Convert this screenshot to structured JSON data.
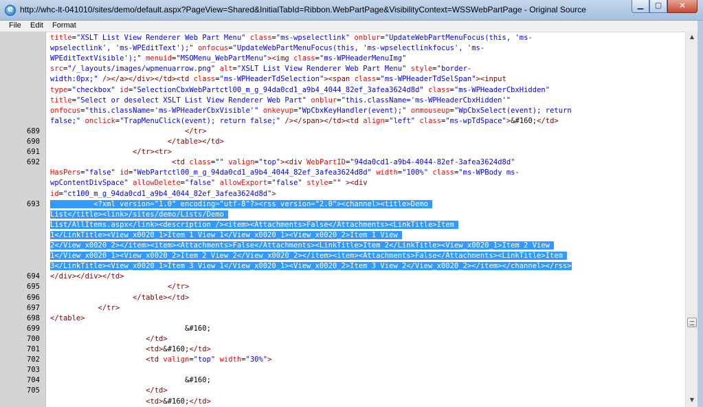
{
  "window": {
    "title": "http://whc-lt-041010/sites/demo/default.aspx?PageView=Shared&InitialTabId=Ribbon.WebPartPage&VisibilityContext=WSSWebPartPage - Original Source",
    "minimize_glyph": "▁",
    "maximize_glyph": "▢",
    "close_glyph": "✕"
  },
  "menu": {
    "file": "File",
    "edit": "Edit",
    "format": "Format"
  },
  "scrollbar": {
    "up": "▲",
    "down": "▼"
  },
  "gutter_numbers": [
    "689",
    "690",
    "691",
    "692",
    "693",
    "694",
    "695",
    "696",
    "697",
    "698",
    "699",
    "700",
    "701",
    "702",
    "703",
    "704",
    "705"
  ],
  "code_lines": [
    {
      "n": "",
      "segs": [
        [
          "a",
          "title"
        ],
        [
          "x",
          "="
        ],
        [
          "v",
          "\"XSLT List View Renderer Web Part Menu\""
        ],
        [
          "x",
          " "
        ],
        [
          "a",
          "class"
        ],
        [
          "x",
          "="
        ],
        [
          "v",
          "\"ms-wpselectlink\""
        ],
        [
          "x",
          " "
        ],
        [
          "a",
          "onblur"
        ],
        [
          "x",
          "="
        ],
        [
          "v",
          "\"UpdateWebPartMenuFocus(this, 'ms-"
        ]
      ]
    },
    {
      "n": "",
      "segs": [
        [
          "v",
          "wpselectlink', 'ms-WPEditText');\""
        ],
        [
          "x",
          " "
        ],
        [
          "a",
          "onfocus"
        ],
        [
          "x",
          "="
        ],
        [
          "v",
          "\"UpdateWebPartMenuFocus(this, 'ms-wpselectlinkfocus', 'ms-"
        ]
      ]
    },
    {
      "n": "",
      "segs": [
        [
          "v",
          "WPEditTextVisible');\""
        ],
        [
          "x",
          " "
        ],
        [
          "a",
          "menuid"
        ],
        [
          "x",
          "="
        ],
        [
          "v",
          "\"MSOMenu_WebPartMenu\""
        ],
        [
          "t",
          "><img"
        ],
        [
          "x",
          " "
        ],
        [
          "a",
          "class"
        ],
        [
          "x",
          "="
        ],
        [
          "v",
          "\"ms-WPHeaderMenuImg\""
        ]
      ]
    },
    {
      "n": "",
      "segs": [
        [
          "a",
          "src"
        ],
        [
          "x",
          "="
        ],
        [
          "v",
          "\"/_layouts/images/wpmenuarrow.png\""
        ],
        [
          "x",
          " "
        ],
        [
          "a",
          "alt"
        ],
        [
          "x",
          "="
        ],
        [
          "v",
          "\"XSLT List View Renderer Web Part Menu\""
        ],
        [
          "x",
          " "
        ],
        [
          "a",
          "style"
        ],
        [
          "x",
          "="
        ],
        [
          "v",
          "\"border-"
        ]
      ]
    },
    {
      "n": "",
      "segs": [
        [
          "v",
          "width:0px;\""
        ],
        [
          "x",
          " "
        ],
        [
          "t",
          "/></a></div></td><td"
        ],
        [
          "x",
          " "
        ],
        [
          "a",
          "class"
        ],
        [
          "x",
          "="
        ],
        [
          "v",
          "\"ms-WPHeaderTdSelection\""
        ],
        [
          "t",
          "><span"
        ],
        [
          "x",
          " "
        ],
        [
          "a",
          "class"
        ],
        [
          "x",
          "="
        ],
        [
          "v",
          "\"ms-WPHeaderTdSelSpan\""
        ],
        [
          "t",
          "><input"
        ]
      ]
    },
    {
      "n": "",
      "segs": [
        [
          "a",
          "type"
        ],
        [
          "x",
          "="
        ],
        [
          "v",
          "\"checkbox\""
        ],
        [
          "x",
          " "
        ],
        [
          "a",
          "id"
        ],
        [
          "x",
          "="
        ],
        [
          "v",
          "\"SelectionCbxWebPartctl00_m_g_94da0cd1_a9b4_4044_82ef_3afea3624d8d\""
        ],
        [
          "x",
          " "
        ],
        [
          "a",
          "class"
        ],
        [
          "x",
          "="
        ],
        [
          "v",
          "\"ms-WPHeaderCbxHidden\""
        ]
      ]
    },
    {
      "n": "",
      "segs": [
        [
          "a",
          "title"
        ],
        [
          "x",
          "="
        ],
        [
          "v",
          "\"Select or deselect XSLT List View Renderer Web Part\""
        ],
        [
          "x",
          " "
        ],
        [
          "a",
          "onblur"
        ],
        [
          "x",
          "="
        ],
        [
          "v",
          "\"this.className='ms-WPHeaderCbxHidden'\""
        ]
      ]
    },
    {
      "n": "",
      "segs": [
        [
          "a",
          "onfocus"
        ],
        [
          "x",
          "="
        ],
        [
          "v",
          "\"this.className='ms-WPHeaderCbxVisible'\""
        ],
        [
          "x",
          " "
        ],
        [
          "a",
          "onkeyup"
        ],
        [
          "x",
          "="
        ],
        [
          "v",
          "\"WpCbxKeyHandler(event);\""
        ],
        [
          "x",
          " "
        ],
        [
          "a",
          "onmouseup"
        ],
        [
          "x",
          "="
        ],
        [
          "v",
          "\"WpCbxSelect(event); return"
        ]
      ]
    },
    {
      "n": "",
      "segs": [
        [
          "v",
          "false;\""
        ],
        [
          "x",
          " "
        ],
        [
          "a",
          "onclick"
        ],
        [
          "x",
          "="
        ],
        [
          "v",
          "\"TrapMenuClick(event); return false;\""
        ],
        [
          "x",
          " "
        ],
        [
          "t",
          "/></span></td><td"
        ],
        [
          "x",
          " "
        ],
        [
          "a",
          "align"
        ],
        [
          "x",
          "="
        ],
        [
          "v",
          "\"left\""
        ],
        [
          "x",
          " "
        ],
        [
          "a",
          "class"
        ],
        [
          "x",
          "="
        ],
        [
          "v",
          "\"ms-wpTdSpace\""
        ],
        [
          "t",
          ">"
        ],
        [
          "e",
          "&#160;"
        ],
        [
          "t",
          "</td>"
        ]
      ]
    },
    {
      "n": "689",
      "segs": [
        [
          "x",
          "                               "
        ],
        [
          "t",
          "</tr>"
        ]
      ]
    },
    {
      "n": "690",
      "segs": [
        [
          "x",
          "                           "
        ],
        [
          "t",
          "</table></td>"
        ]
      ]
    },
    {
      "n": "691",
      "segs": [
        [
          "x",
          "                   "
        ],
        [
          "t",
          "</tr><tr>"
        ]
      ]
    },
    {
      "n": "692",
      "segs": [
        [
          "x",
          "                            "
        ],
        [
          "t",
          "<td"
        ],
        [
          "x",
          " "
        ],
        [
          "a",
          "class"
        ],
        [
          "x",
          "="
        ],
        [
          "v",
          "\"\""
        ],
        [
          "x",
          " "
        ],
        [
          "a",
          "valign"
        ],
        [
          "x",
          "="
        ],
        [
          "v",
          "\"top\""
        ],
        [
          "t",
          "><div"
        ],
        [
          "x",
          " "
        ],
        [
          "a",
          "WebPartID"
        ],
        [
          "x",
          "="
        ],
        [
          "v",
          "\"94da0cd1-a9b4-4044-82ef-3afea3624d8d\""
        ]
      ]
    },
    {
      "n": "",
      "segs": [
        [
          "a",
          "HasPers"
        ],
        [
          "x",
          "="
        ],
        [
          "v",
          "\"false\""
        ],
        [
          "x",
          " "
        ],
        [
          "a",
          "id"
        ],
        [
          "x",
          "="
        ],
        [
          "v",
          "\"WebPartctl00_m_g_94da0cd1_a9b4_4044_82ef_3afea3624d8d\""
        ],
        [
          "x",
          " "
        ],
        [
          "a",
          "width"
        ],
        [
          "x",
          "="
        ],
        [
          "v",
          "\"100%\""
        ],
        [
          "x",
          " "
        ],
        [
          "a",
          "class"
        ],
        [
          "x",
          "="
        ],
        [
          "v",
          "\"ms-WPBody ms-"
        ]
      ]
    },
    {
      "n": "",
      "segs": [
        [
          "v",
          "wpContentDivSpace\""
        ],
        [
          "x",
          " "
        ],
        [
          "a",
          "allowDelete"
        ],
        [
          "x",
          "="
        ],
        [
          "v",
          "\"false\""
        ],
        [
          "x",
          " "
        ],
        [
          "a",
          "allowExport"
        ],
        [
          "x",
          "="
        ],
        [
          "v",
          "\"false\""
        ],
        [
          "x",
          " "
        ],
        [
          "a",
          "style"
        ],
        [
          "x",
          "="
        ],
        [
          "v",
          "\"\""
        ],
        [
          "x",
          " "
        ],
        [
          "t",
          "><div"
        ]
      ]
    },
    {
      "n": "",
      "segs": [
        [
          "a",
          "id"
        ],
        [
          "x",
          "="
        ],
        [
          "v",
          "\"ct100_m_g_94da0cd1_a9b4_4044_82ef_3afea3624d8d\""
        ],
        [
          "t",
          ">"
        ]
      ]
    },
    {
      "n": "693",
      "sel": true,
      "segs": [
        [
          "x",
          "          <?xml version=\"1.0\" encoding=\"utf-8\"?><rss version=\"2.0\"><channel><title>Demo "
        ]
      ]
    },
    {
      "n": "",
      "sel": true,
      "segs": [
        [
          "x",
          "List</title><link>/sites/demo/Lists/Demo "
        ]
      ]
    },
    {
      "n": "",
      "sel": true,
      "segs": [
        [
          "x",
          "List/AllItems.aspx</link><description /><item><Attachments>False</Attachments><LinkTitle>Item "
        ]
      ]
    },
    {
      "n": "",
      "sel": true,
      "segs": [
        [
          "x",
          "1</LinkTitle><View_x0020_1>Item 1 View 1</View_x0020_1><View_x0020_2>Item 1 View "
        ]
      ]
    },
    {
      "n": "",
      "sel": true,
      "segs": [
        [
          "x",
          "2</View_x0020_2></item><item><Attachments>False</Attachments><LinkTitle>Item 2</LinkTitle><View_x0020_1>Item 2 View "
        ]
      ]
    },
    {
      "n": "",
      "sel": true,
      "segs": [
        [
          "x",
          "1</View_x0020_1><View_x0020_2>Item 2 View 2</View_x0020_2></item><item><Attachments>False</Attachments><LinkTitle>Item "
        ]
      ]
    },
    {
      "n": "",
      "sel": true,
      "segs": [
        [
          "x",
          "3</LinkTitle><View_x0020_1>Item 3 View 1</View_x0020_1><View_x0020_2>Item 3 View 2</View_x0020_2></item></channel></rss>"
        ]
      ]
    },
    {
      "n": "694",
      "segs": [
        [
          "t",
          "</div></div></td>"
        ]
      ]
    },
    {
      "n": "695",
      "segs": [
        [
          "x",
          "                           "
        ],
        [
          "t",
          "</tr>"
        ]
      ]
    },
    {
      "n": "696",
      "segs": [
        [
          "x",
          "                   "
        ],
        [
          "t",
          "</table></td>"
        ]
      ]
    },
    {
      "n": "697",
      "segs": [
        [
          "x",
          "           "
        ],
        [
          "t",
          "</tr>"
        ]
      ]
    },
    {
      "n": "698",
      "segs": [
        [
          "t",
          "</table>"
        ]
      ]
    },
    {
      "n": "699",
      "segs": [
        [
          "x",
          "                               "
        ],
        [
          "e",
          "&#160;"
        ]
      ]
    },
    {
      "n": "700",
      "segs": [
        [
          "x",
          "                      "
        ],
        [
          "t",
          "</td>"
        ]
      ]
    },
    {
      "n": "701",
      "segs": [
        [
          "x",
          "                      "
        ],
        [
          "t",
          "<td>"
        ],
        [
          "e",
          "&#160;"
        ],
        [
          "t",
          "</td>"
        ]
      ]
    },
    {
      "n": "702",
      "segs": [
        [
          "x",
          "                      "
        ],
        [
          "t",
          "<td"
        ],
        [
          "x",
          " "
        ],
        [
          "a",
          "valign"
        ],
        [
          "x",
          "="
        ],
        [
          "v",
          "\"top\""
        ],
        [
          "x",
          " "
        ],
        [
          "a",
          "width"
        ],
        [
          "x",
          "="
        ],
        [
          "v",
          "\"30%\""
        ],
        [
          "t",
          ">"
        ]
      ]
    },
    {
      "n": "703",
      "segs": [
        [
          "x",
          ""
        ]
      ]
    },
    {
      "n": "704",
      "segs": [
        [
          "x",
          "                               "
        ],
        [
          "e",
          "&#160;"
        ]
      ]
    },
    {
      "n": "705",
      "segs": [
        [
          "x",
          "                      "
        ],
        [
          "t",
          "</td>"
        ]
      ]
    },
    {
      "n": "",
      "segs": [
        [
          "x",
          "                      "
        ],
        [
          "t",
          "<td>"
        ],
        [
          "e",
          "&#160;"
        ],
        [
          "t",
          "</td>"
        ]
      ]
    }
  ]
}
